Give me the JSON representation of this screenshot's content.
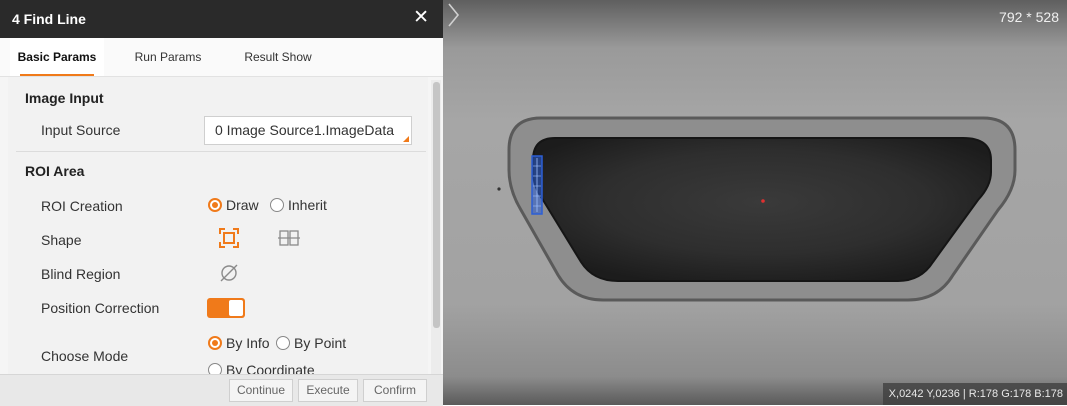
{
  "window": {
    "title": "4 Find Line",
    "close_glyph": "✕"
  },
  "tabs": [
    {
      "label": "Basic Params",
      "active": true
    },
    {
      "label": "Run Params",
      "active": false
    },
    {
      "label": "Result Show",
      "active": false
    }
  ],
  "image_input": {
    "section_title": "Image Input",
    "input_source_label": "Input Source",
    "input_source_value": "0 Image Source1.ImageData"
  },
  "roi_area": {
    "section_title": "ROI Area",
    "roi_creation_label": "ROI Creation",
    "roi_options": [
      {
        "label": "Draw",
        "selected": true
      },
      {
        "label": "Inherit",
        "selected": false
      }
    ],
    "shape_label": "Shape",
    "shape_icons": [
      "rectangle-roi-icon",
      "multi-roi-icon"
    ],
    "blind_region_label": "Blind Region",
    "blind_region_icon": "blind-region-icon",
    "position_correction_label": "Position Correction",
    "position_correction_on": true,
    "choose_mode_label": "Choose Mode",
    "mode_options": [
      {
        "label": "By Info",
        "selected": true
      },
      {
        "label": "By Point",
        "selected": false
      },
      {
        "label": "By Coordinate",
        "selected": false
      }
    ]
  },
  "footer": {
    "buttons": [
      "Continue",
      "Execute",
      "Confirm"
    ]
  },
  "viewer": {
    "dimensions": "792 * 528",
    "status": "X,0242  Y,0236  |  R:178  G:178  B:178",
    "next_icon": "chevron-right-icon"
  },
  "colors": {
    "accent": "#f07a1a",
    "titlebar": "#2a2a2a",
    "roi": "#2c5fd6",
    "center_marker": "#e03030"
  }
}
